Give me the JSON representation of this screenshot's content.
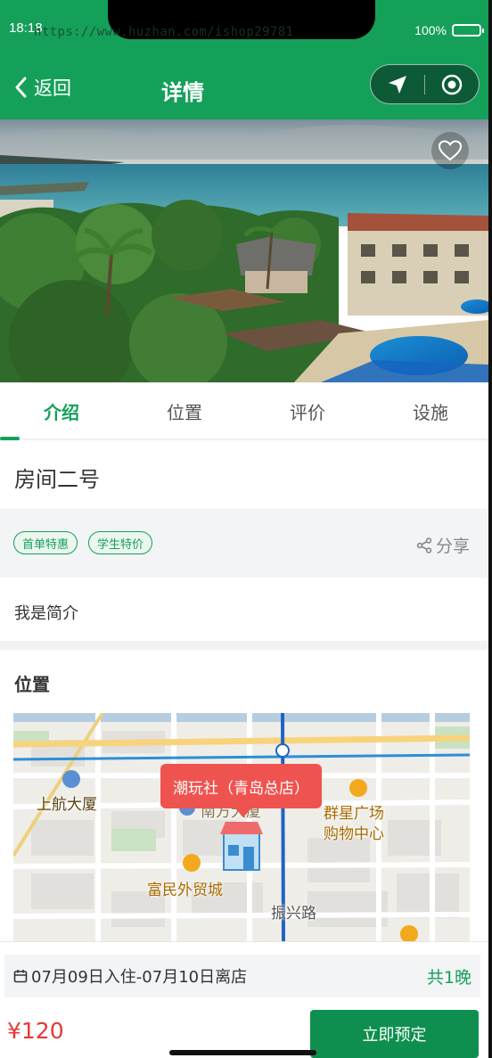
{
  "status_bar": {
    "time": "18:18",
    "url_watermark": "https://www.huzhan.com/ishop29781",
    "battery": "100%"
  },
  "nav": {
    "back_label": "返回",
    "title": "详情"
  },
  "tabs": [
    {
      "label": "介绍",
      "active": true
    },
    {
      "label": "位置",
      "active": false
    },
    {
      "label": "评价",
      "active": false
    },
    {
      "label": "设施",
      "active": false
    }
  ],
  "room": {
    "name": "房间二号",
    "tags": [
      "首单特惠",
      "学生特价"
    ],
    "share_label": "分享",
    "intro": "我是简介"
  },
  "location": {
    "section_title": "位置",
    "map_labels": {
      "store": "潮玩社（青岛总店）",
      "building_1": "上航大厦",
      "building_2": "南方大厦",
      "mall_line1": "群星广场",
      "mall_line2": "购物中心",
      "trade_center": "富民外贸城",
      "road": "振兴路"
    }
  },
  "booking": {
    "dates": "07月09日入住-07月10日离店",
    "nights": "共1晚",
    "price": "¥120",
    "button_label": "立即预定"
  },
  "colors": {
    "brand_green": "#15a05a",
    "price_red": "#e53935",
    "callout_red": "#ef5350"
  }
}
